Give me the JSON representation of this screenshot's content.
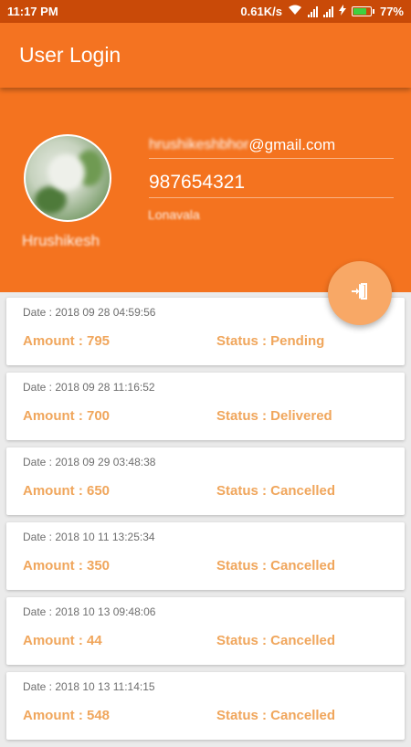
{
  "status_bar": {
    "time": "11:17 PM",
    "network_speed": "0.61K/s",
    "battery_percent": "77%",
    "battery_level": 0.77
  },
  "app_bar": {
    "title": "User Login"
  },
  "profile": {
    "email_prefix": "hrushikeshbhor",
    "email_domain": "@gmail.com",
    "phone": "987654321",
    "city": "Lonavala",
    "name": "Hrushikesh"
  },
  "fab": {
    "icon": "exit-door-icon"
  },
  "orders": [
    {
      "date": "Date : 2018 09 28 04:59:56",
      "amount": "Amount : 795",
      "status": "Status : Pending"
    },
    {
      "date": "Date : 2018 09 28 11:16:52",
      "amount": "Amount : 700",
      "status": "Status : Delivered"
    },
    {
      "date": "Date : 2018 09 29 03:48:38",
      "amount": "Amount : 650",
      "status": "Status : Cancelled"
    },
    {
      "date": "Date : 2018 10 11 13:25:34",
      "amount": "Amount : 350",
      "status": "Status : Cancelled"
    },
    {
      "date": "Date : 2018 10 13 09:48:06",
      "amount": "Amount : 44",
      "status": "Status : Cancelled"
    },
    {
      "date": "Date : 2018 10 13 11:14:15",
      "amount": "Amount : 548",
      "status": "Status : Cancelled"
    }
  ],
  "colors": {
    "primary": "#f47321",
    "status_bar": "#c94a08",
    "accent_text": "#f0a65c",
    "fab": "#f8a866"
  }
}
